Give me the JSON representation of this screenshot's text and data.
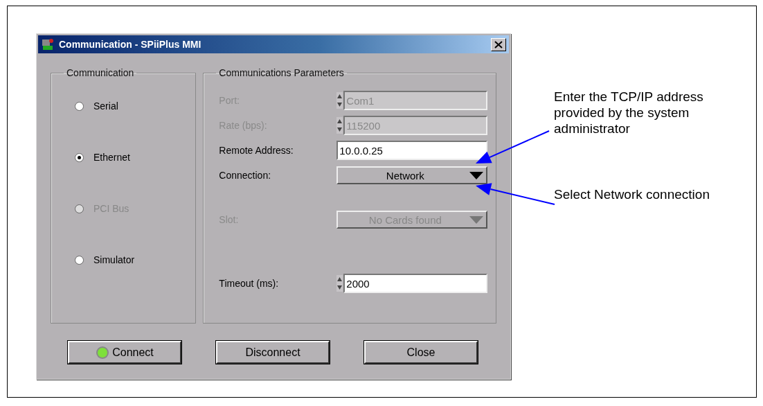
{
  "window": {
    "title": "Communication - SPiiPlus MMI"
  },
  "communication": {
    "title": "Communication",
    "options": [
      {
        "label": "Serial",
        "selected": false,
        "disabled": false
      },
      {
        "label": "Ethernet",
        "selected": true,
        "disabled": false
      },
      {
        "label": "PCI Bus",
        "selected": false,
        "disabled": true
      },
      {
        "label": "Simulator",
        "selected": false,
        "disabled": false
      }
    ]
  },
  "parameters": {
    "title": "Communications Parameters",
    "fields": [
      {
        "kind": "spin",
        "label": "Port:",
        "value": "Com1",
        "disabled": true
      },
      {
        "kind": "spin",
        "label": "Rate (bps):",
        "value": "115200",
        "disabled": true
      },
      {
        "kind": "text",
        "label": "Remote Address:",
        "value": "10.0.0.25",
        "disabled": false
      },
      {
        "kind": "dropdown",
        "label": "Connection:",
        "value": "Network",
        "disabled": false
      },
      {
        "kind": "gap"
      },
      {
        "kind": "dropdown",
        "label": "Slot:",
        "value": "No Cards found",
        "disabled": true
      },
      {
        "kind": "gap"
      },
      {
        "kind": "gap"
      },
      {
        "kind": "spin",
        "label": "Timeout (ms):",
        "value": "2000",
        "disabled": false
      }
    ]
  },
  "buttons": [
    {
      "label": "Connect",
      "led": true
    },
    {
      "label": "Disconnect",
      "led": false
    },
    {
      "label": "Close",
      "led": false
    }
  ],
  "annotations": [
    {
      "text": "Enter the TCP/IP address provided by the system administrator"
    },
    {
      "text": "Select Network connection"
    }
  ]
}
